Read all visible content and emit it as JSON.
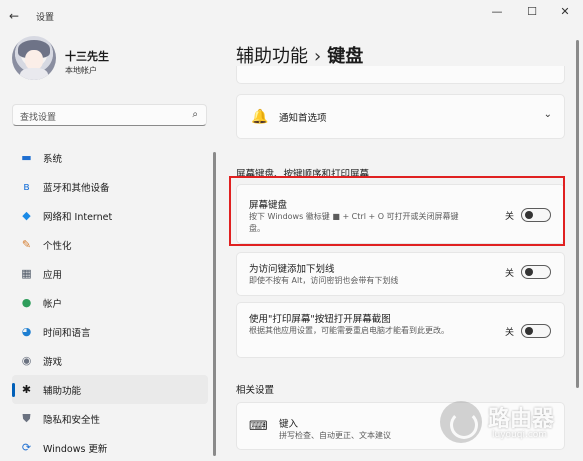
{
  "window": {
    "app_title": "设置",
    "back_icon": "←",
    "minimize_icon": "—",
    "maximize_icon": "☐",
    "close_icon": "✕"
  },
  "profile": {
    "name": "十三先生",
    "account_type": "本地帐户"
  },
  "search": {
    "placeholder": "查找设置",
    "icon": "⌕"
  },
  "sidebar": {
    "items": [
      {
        "label": "系统",
        "icon": "▬",
        "color": "#1f6fd1"
      },
      {
        "label": "蓝牙和其他设备",
        "icon": "ʙ",
        "color": "#1c73d9"
      },
      {
        "label": "网络和 Internet",
        "icon": "◆",
        "color": "#1a8ae6"
      },
      {
        "label": "个性化",
        "icon": "✎",
        "color": "#d47a2a"
      },
      {
        "label": "应用",
        "icon": "▦",
        "color": "#4b5563"
      },
      {
        "label": "帐户",
        "icon": "●",
        "color": "#2e9d5b"
      },
      {
        "label": "时间和语言",
        "icon": "◕",
        "color": "#1f7fd1"
      },
      {
        "label": "游戏",
        "icon": "◉",
        "color": "#6b7280"
      },
      {
        "label": "辅助功能",
        "icon": "✱",
        "color": "#1b1b1b"
      },
      {
        "label": "隐私和安全性",
        "icon": "⛊",
        "color": "#6b7280"
      },
      {
        "label": "Windows 更新",
        "icon": "⟳",
        "color": "#1f6fd1"
      }
    ],
    "active_index": 8
  },
  "main": {
    "breadcrumb_parent": "辅助功能",
    "breadcrumb_sep": "›",
    "breadcrumb_current": "键盘",
    "notifications": {
      "icon": "🔔",
      "label": "通知首选项",
      "chevron": "⌄"
    },
    "section_keyboard": "屏幕键盘、按键顺序和打印屏幕",
    "osk": {
      "title": "屏幕键盘",
      "desc": "按下 Windows 徽标键 ■ + Ctrl + O 可打开或关闭屏幕键盘。",
      "state": "关"
    },
    "underline": {
      "title": "为访问键添加下划线",
      "desc": "即使不按有 Alt，访问密钥也会带有下划线",
      "state": "关"
    },
    "prtscn": {
      "title": "使用\"打印屏幕\"按钮打开屏幕截图",
      "desc": "根据其他应用设置，可能需要重启电脑才能看到此更改。",
      "state": "关"
    },
    "section_related": "相关设置",
    "typing": {
      "icon": "⌨",
      "title": "键入",
      "desc": "拼写检查、自动更正、文本建议",
      "chevron": "›"
    }
  },
  "watermark": {
    "main": "路由器",
    "sub": "luyouqi.com"
  },
  "colors": {
    "accent": "#005fb8",
    "highlight_border": "#e02020"
  }
}
